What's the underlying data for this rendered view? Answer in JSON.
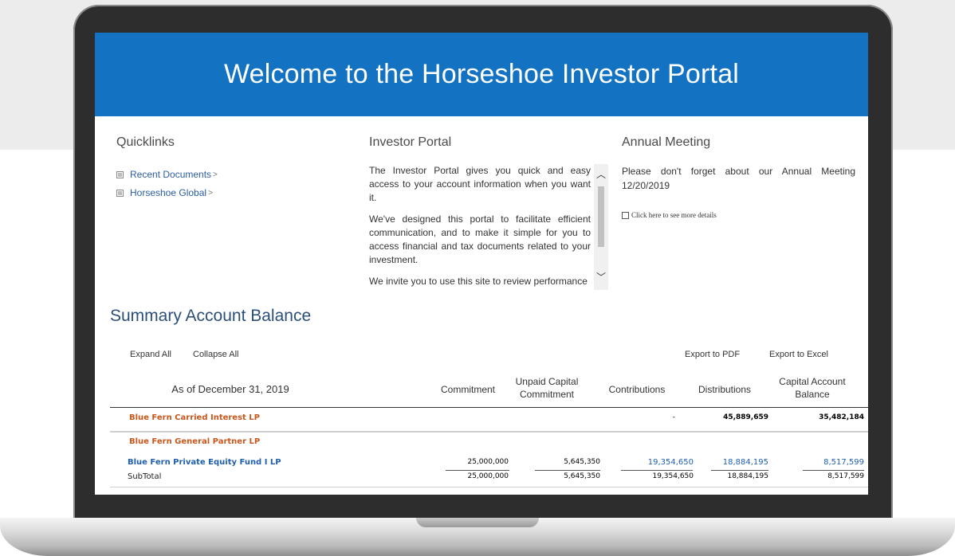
{
  "banner": {
    "title": "Welcome to the Horseshoe Investor Portal"
  },
  "quicklinks": {
    "title": "Quicklinks",
    "items": [
      {
        "label": "Recent Documents",
        "arrow": ">"
      },
      {
        "label": "Horseshoe Global",
        "arrow": ">"
      }
    ]
  },
  "investor_portal": {
    "title": "Investor Portal",
    "paragraphs": [
      "The Investor Portal gives you quick and easy access to your account information when you want it.",
      "We've designed this portal to facilitate efficient communication, and to make it simple for you to access financial and tax documents related to your investment.",
      "We invite you to use this site to review performance"
    ]
  },
  "annual_meeting": {
    "title": "Annual Meeting",
    "text": "Please don't forget about our Annual Meeting 12/20/2019",
    "link": "Click here to see more details"
  },
  "summary": {
    "title": "Summary Account Balance",
    "expand_all": "Expand All",
    "collapse_all": "Collapse All",
    "export_pdf": "Export to PDF",
    "export_excel": "Export to Excel",
    "as_of": "As of December 31, 2019",
    "columns": {
      "commitment": "Commitment",
      "unpaid_line1": "Unpaid Capital",
      "unpaid_line2": "Commitment",
      "contributions": "Contributions",
      "distributions": "Distributions",
      "balance_line1": "Capital Account",
      "balance_line2": "Balance"
    },
    "rows": {
      "carried": {
        "name": "Blue Fern Carried Interest LP",
        "contributions": "-",
        "distributions": "45,889,659",
        "balance": "35,482,184"
      },
      "general": {
        "name": "Blue Fern General Partner LP"
      },
      "fund": {
        "name": "Blue Fern Private Equity Fund I LP",
        "commitment": "25,000,000",
        "unpaid": "5,645,350",
        "contributions": "19,354,650",
        "distributions": "18,884,195",
        "balance": "8,517,599"
      },
      "subtotal": {
        "name": "SubTotal",
        "commitment": "25,000,000",
        "unpaid": "5,645,350",
        "contributions": "19,354,650",
        "distributions": "18,884,195",
        "balance": "8,517,599"
      }
    },
    "colors": {
      "orange_link": "#c9561a",
      "blue_link": "#1f5fae",
      "title_blue": "#2b4f7a"
    }
  }
}
